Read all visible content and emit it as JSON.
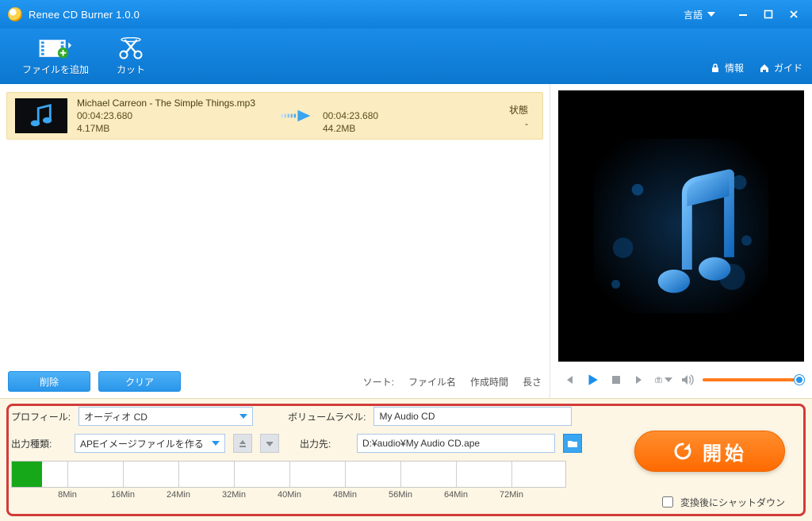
{
  "window": {
    "title": "Renee CD Burner 1.0.0"
  },
  "header": {
    "language_label": "言語",
    "info_label": "情報",
    "guide_label": "ガイド"
  },
  "toolbar": {
    "add_files_label": "ファイルを追加",
    "cut_label": "カット"
  },
  "filelist": {
    "items": [
      {
        "name": "Michael Carreon - The Simple Things.mp3",
        "src_duration": "00:04:23.680",
        "src_size": "4.17MB",
        "dst_duration": "00:04:23.680",
        "dst_size": "44.2MB",
        "status_label": "状態",
        "status_value": "-"
      }
    ],
    "buttons": {
      "delete": "削除",
      "clear": "クリア"
    },
    "sort": {
      "label": "ソート:",
      "by_name": "ファイル名",
      "by_ctime": "作成時間",
      "by_length": "長さ"
    }
  },
  "settings": {
    "profile_label": "プロフィール:",
    "profile_value": "オーディオ CD",
    "output_type_label": "出力種類:",
    "output_type_value": "APEイメージファイルを作る",
    "volume_label_label": "ボリュームラベル:",
    "volume_label_value": "My Audio CD",
    "output_path_label": "出力先:",
    "output_path_value": "D:¥audio¥My Audio CD.ape",
    "ruler_ticks": [
      "8Min",
      "16Min",
      "24Min",
      "32Min",
      "40Min",
      "48Min",
      "56Min",
      "64Min",
      "72Min"
    ],
    "start_label": "開始",
    "shutdown_label": "変換後にシャットダウン"
  },
  "icons": {
    "search": "",
    "gear": ""
  },
  "colors": {
    "accent": "#1c8eea",
    "orange": "#ff7a1a",
    "green": "#17a81a"
  }
}
